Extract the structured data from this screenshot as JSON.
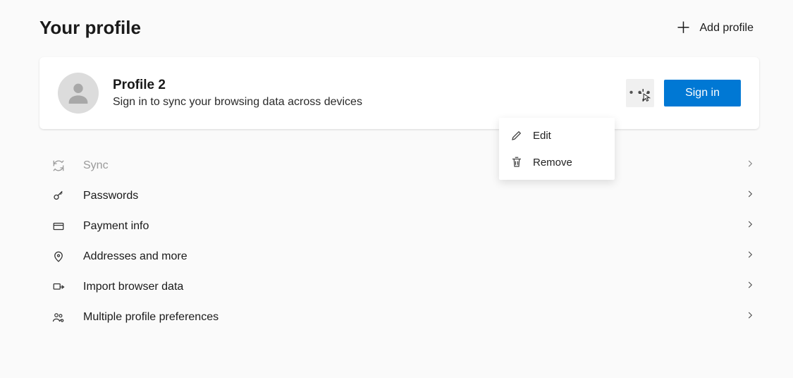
{
  "header": {
    "title": "Your profile",
    "add_profile": "Add profile"
  },
  "profile": {
    "name": "Profile 2",
    "subtitle": "Sign in to sync your browsing data across devices",
    "signin": "Sign in"
  },
  "dropdown": {
    "edit": "Edit",
    "remove": "Remove"
  },
  "rows": {
    "sync": "Sync",
    "passwords": "Passwords",
    "payment": "Payment info",
    "addresses": "Addresses and more",
    "import": "Import browser data",
    "multiple": "Multiple profile preferences"
  }
}
